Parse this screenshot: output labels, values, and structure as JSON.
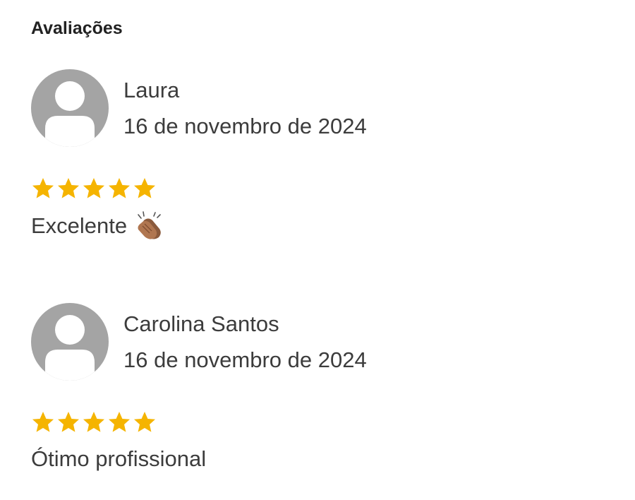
{
  "section": {
    "title": "Avaliações"
  },
  "reviews": [
    {
      "name": "Laura",
      "date": "16 de novembro de 2024",
      "rating": 5,
      "rating_max": 5,
      "text": "Excelente",
      "emoji_icon": "clapping-hands-icon",
      "avatar_icon": "default-user-avatar-icon"
    },
    {
      "name": "Carolina Santos",
      "date": "16 de novembro de 2024",
      "rating": 5,
      "rating_max": 5,
      "text": "Ótimo profissional",
      "avatar_icon": "default-user-avatar-icon"
    }
  ],
  "colors": {
    "star": "#f5b400",
    "avatar_bg": "#a4a4a4",
    "avatar_fg": "#ffffff",
    "text": "#3c3c3c"
  }
}
